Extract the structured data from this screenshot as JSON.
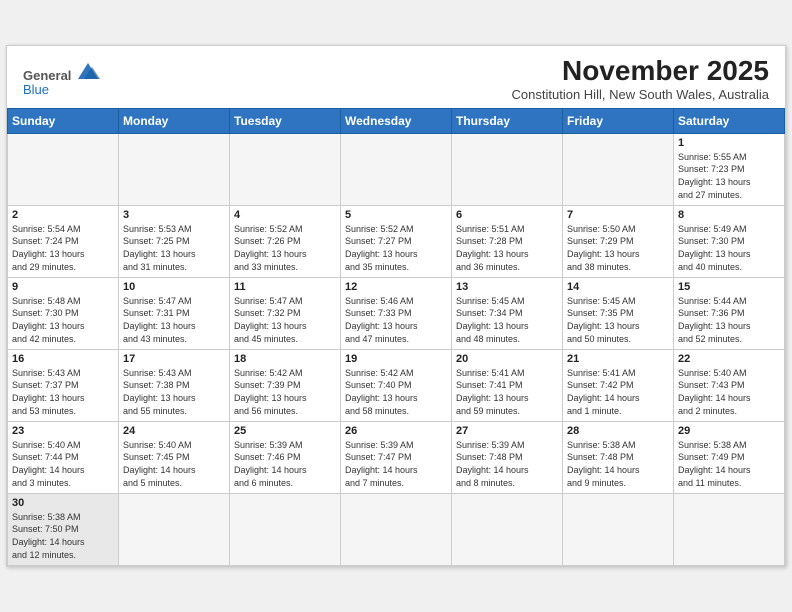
{
  "header": {
    "logo_general": "General",
    "logo_blue": "Blue",
    "month_title": "November 2025",
    "subtitle": "Constitution Hill, New South Wales, Australia"
  },
  "weekdays": [
    "Sunday",
    "Monday",
    "Tuesday",
    "Wednesday",
    "Thursday",
    "Friday",
    "Saturday"
  ],
  "weeks": [
    [
      {
        "day": "",
        "info": ""
      },
      {
        "day": "",
        "info": ""
      },
      {
        "day": "",
        "info": ""
      },
      {
        "day": "",
        "info": ""
      },
      {
        "day": "",
        "info": ""
      },
      {
        "day": "",
        "info": ""
      },
      {
        "day": "1",
        "info": "Sunrise: 5:55 AM\nSunset: 7:23 PM\nDaylight: 13 hours\nand 27 minutes."
      }
    ],
    [
      {
        "day": "2",
        "info": "Sunrise: 5:54 AM\nSunset: 7:24 PM\nDaylight: 13 hours\nand 29 minutes."
      },
      {
        "day": "3",
        "info": "Sunrise: 5:53 AM\nSunset: 7:25 PM\nDaylight: 13 hours\nand 31 minutes."
      },
      {
        "day": "4",
        "info": "Sunrise: 5:52 AM\nSunset: 7:26 PM\nDaylight: 13 hours\nand 33 minutes."
      },
      {
        "day": "5",
        "info": "Sunrise: 5:52 AM\nSunset: 7:27 PM\nDaylight: 13 hours\nand 35 minutes."
      },
      {
        "day": "6",
        "info": "Sunrise: 5:51 AM\nSunset: 7:28 PM\nDaylight: 13 hours\nand 36 minutes."
      },
      {
        "day": "7",
        "info": "Sunrise: 5:50 AM\nSunset: 7:29 PM\nDaylight: 13 hours\nand 38 minutes."
      },
      {
        "day": "8",
        "info": "Sunrise: 5:49 AM\nSunset: 7:30 PM\nDaylight: 13 hours\nand 40 minutes."
      }
    ],
    [
      {
        "day": "9",
        "info": "Sunrise: 5:48 AM\nSunset: 7:30 PM\nDaylight: 13 hours\nand 42 minutes."
      },
      {
        "day": "10",
        "info": "Sunrise: 5:47 AM\nSunset: 7:31 PM\nDaylight: 13 hours\nand 43 minutes."
      },
      {
        "day": "11",
        "info": "Sunrise: 5:47 AM\nSunset: 7:32 PM\nDaylight: 13 hours\nand 45 minutes."
      },
      {
        "day": "12",
        "info": "Sunrise: 5:46 AM\nSunset: 7:33 PM\nDaylight: 13 hours\nand 47 minutes."
      },
      {
        "day": "13",
        "info": "Sunrise: 5:45 AM\nSunset: 7:34 PM\nDaylight: 13 hours\nand 48 minutes."
      },
      {
        "day": "14",
        "info": "Sunrise: 5:45 AM\nSunset: 7:35 PM\nDaylight: 13 hours\nand 50 minutes."
      },
      {
        "day": "15",
        "info": "Sunrise: 5:44 AM\nSunset: 7:36 PM\nDaylight: 13 hours\nand 52 minutes."
      }
    ],
    [
      {
        "day": "16",
        "info": "Sunrise: 5:43 AM\nSunset: 7:37 PM\nDaylight: 13 hours\nand 53 minutes."
      },
      {
        "day": "17",
        "info": "Sunrise: 5:43 AM\nSunset: 7:38 PM\nDaylight: 13 hours\nand 55 minutes."
      },
      {
        "day": "18",
        "info": "Sunrise: 5:42 AM\nSunset: 7:39 PM\nDaylight: 13 hours\nand 56 minutes."
      },
      {
        "day": "19",
        "info": "Sunrise: 5:42 AM\nSunset: 7:40 PM\nDaylight: 13 hours\nand 58 minutes."
      },
      {
        "day": "20",
        "info": "Sunrise: 5:41 AM\nSunset: 7:41 PM\nDaylight: 13 hours\nand 59 minutes."
      },
      {
        "day": "21",
        "info": "Sunrise: 5:41 AM\nSunset: 7:42 PM\nDaylight: 14 hours\nand 1 minute."
      },
      {
        "day": "22",
        "info": "Sunrise: 5:40 AM\nSunset: 7:43 PM\nDaylight: 14 hours\nand 2 minutes."
      }
    ],
    [
      {
        "day": "23",
        "info": "Sunrise: 5:40 AM\nSunset: 7:44 PM\nDaylight: 14 hours\nand 3 minutes."
      },
      {
        "day": "24",
        "info": "Sunrise: 5:40 AM\nSunset: 7:45 PM\nDaylight: 14 hours\nand 5 minutes."
      },
      {
        "day": "25",
        "info": "Sunrise: 5:39 AM\nSunset: 7:46 PM\nDaylight: 14 hours\nand 6 minutes."
      },
      {
        "day": "26",
        "info": "Sunrise: 5:39 AM\nSunset: 7:47 PM\nDaylight: 14 hours\nand 7 minutes."
      },
      {
        "day": "27",
        "info": "Sunrise: 5:39 AM\nSunset: 7:48 PM\nDaylight: 14 hours\nand 8 minutes."
      },
      {
        "day": "28",
        "info": "Sunrise: 5:38 AM\nSunset: 7:48 PM\nDaylight: 14 hours\nand 9 minutes."
      },
      {
        "day": "29",
        "info": "Sunrise: 5:38 AM\nSunset: 7:49 PM\nDaylight: 14 hours\nand 11 minutes."
      }
    ],
    [
      {
        "day": "30",
        "info": "Sunrise: 5:38 AM\nSunset: 7:50 PM\nDaylight: 14 hours\nand 12 minutes."
      },
      {
        "day": "",
        "info": ""
      },
      {
        "day": "",
        "info": ""
      },
      {
        "day": "",
        "info": ""
      },
      {
        "day": "",
        "info": ""
      },
      {
        "day": "",
        "info": ""
      },
      {
        "day": "",
        "info": ""
      }
    ]
  ]
}
